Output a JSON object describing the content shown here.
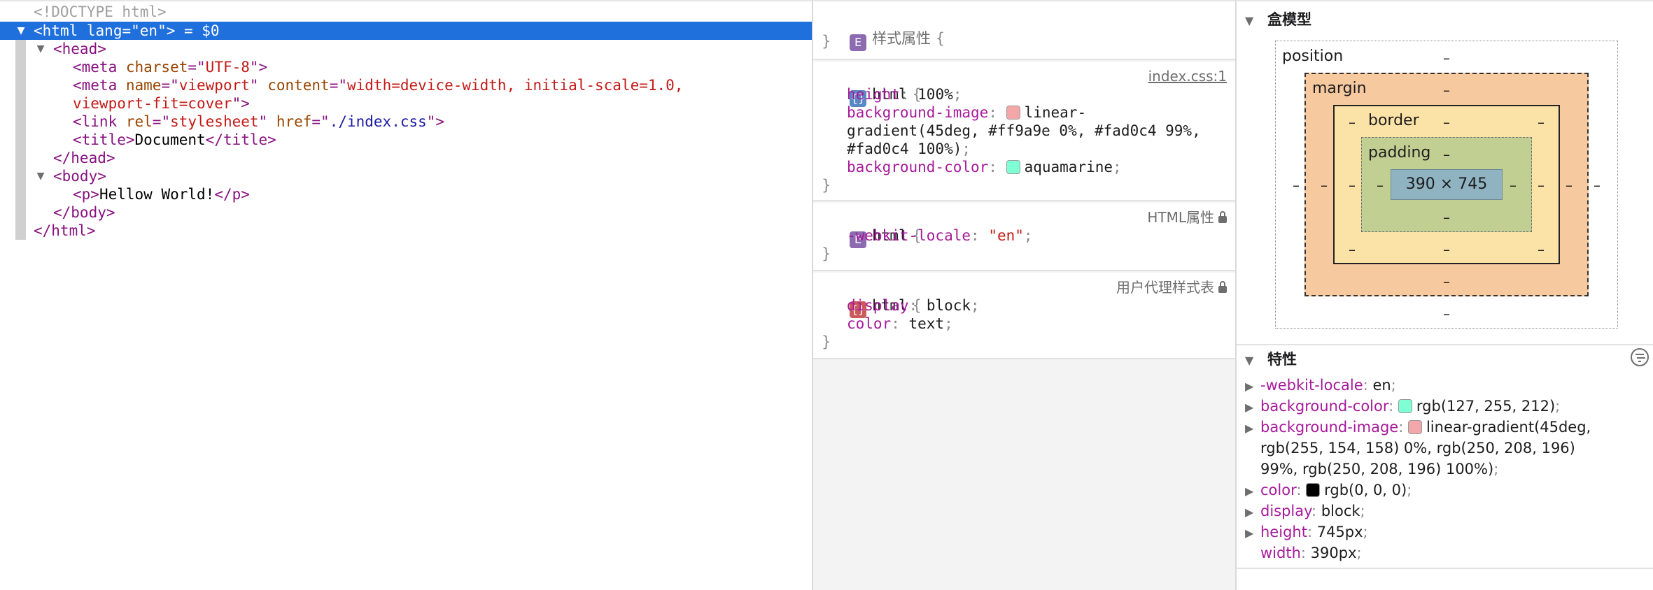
{
  "dom_tree": {
    "doctype": "<!DOCTYPE html>",
    "html_open": {
      "tag": "html",
      "attr_name": "lang",
      "attr_value": "en",
      "suffix": " = $0"
    },
    "head_open": "<head>",
    "meta_charset": {
      "attr_name": "charset",
      "attr_value": "UTF-8"
    },
    "meta_viewport": {
      "name_attr": "name",
      "name_value": "viewport",
      "content_attr": "content",
      "content_value_line1": "width=device-width, initial-scale=1.0,",
      "content_value_line2": "viewport-fit=cover"
    },
    "link": {
      "rel_attr": "rel",
      "rel_value": "stylesheet",
      "href_attr": "href",
      "href_value": "./index.css"
    },
    "title": {
      "text": "Document"
    },
    "head_close": "</head>",
    "body_open": "<body>",
    "p": {
      "text": "Hellow World!"
    },
    "body_close": "</body>",
    "html_close": "</html>"
  },
  "styles": {
    "style_attr_rule": {
      "badge": "E",
      "title": "样式属性",
      "open": "{",
      "close": "}"
    },
    "author_rule": {
      "badge": "{}",
      "selector": "html",
      "origin": "index.css:1",
      "props": [
        {
          "name": "height",
          "value": "100%"
        },
        {
          "name": "background-image",
          "value_line1": "linear-",
          "value_line2": "gradient(45deg, #ff9a9e 0%, #fad0c4 99%,",
          "value_line3": "#fad0c4 100%)",
          "swatch": "#ff9a9e"
        },
        {
          "name": "background-color",
          "value": "aquamarine",
          "swatch": "#7fffd4"
        }
      ]
    },
    "html_attr_rule": {
      "badge": "E",
      "selector": "html",
      "origin": "HTML属性",
      "props": [
        {
          "name": "-webkit-locale",
          "value": "\"en\""
        }
      ]
    },
    "ua_rule": {
      "badge": "{}",
      "selector": "html",
      "origin": "用户代理样式表",
      "props": [
        {
          "name": "display",
          "value": "block"
        },
        {
          "name": "color",
          "value": "text"
        }
      ]
    }
  },
  "box_model": {
    "title": "盒模型",
    "position_label": "position",
    "margin_label": "margin",
    "border_label": "border",
    "padding_label": "padding",
    "content_size": "390 × 745",
    "dash": "–",
    "colors": {
      "margin": "#f6c99e",
      "border": "#fbe2a6",
      "padding": "#c2cf92",
      "content": "#8fb3c0"
    }
  },
  "computed": {
    "title": "特性",
    "rows": [
      {
        "name": "-webkit-locale",
        "value": "en"
      },
      {
        "name": "background-color",
        "value": "rgb(127, 255, 212)",
        "swatch": "#7fffd4"
      },
      {
        "name": "background-image",
        "value": "linear-gradient(45deg,",
        "swatch": "#ff9a9e",
        "cont1": "rgb(255, 154, 158) 0%, rgb(250, 208, 196)",
        "cont2": "99%, rgb(250, 208, 196) 100%)"
      },
      {
        "name": "color",
        "value": "rgb(0, 0, 0)",
        "swatch": "#000000"
      },
      {
        "name": "display",
        "value": "block"
      },
      {
        "name": "height",
        "value": "745px"
      },
      {
        "name": "width",
        "value": "390px"
      }
    ]
  }
}
